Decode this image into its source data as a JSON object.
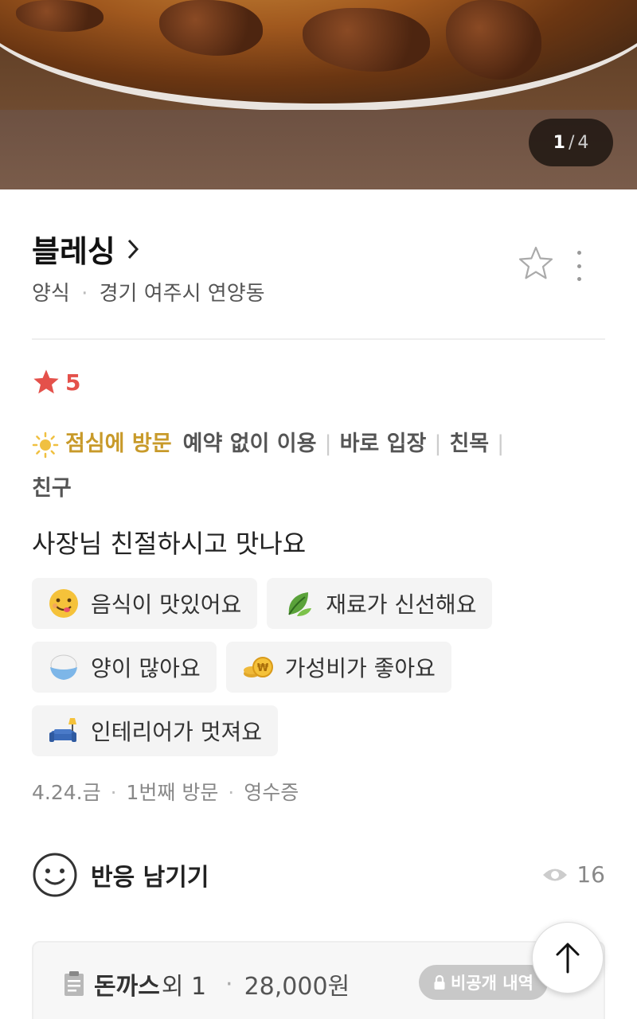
{
  "photo_counter": {
    "current": "1",
    "separator": "/",
    "total": "4"
  },
  "place": {
    "name": "블레싱",
    "category": "양식",
    "location": "경기 여주시 연양동"
  },
  "review": {
    "rating": "5",
    "visit_time": "점심에 방문",
    "visit_details": [
      "예약 없이 이용",
      "바로 입장",
      "친목",
      "친구"
    ],
    "text": "사장님 친절하시고 맛나요",
    "tags": [
      {
        "icon": "yum-face-icon",
        "label": "음식이 맛있어요"
      },
      {
        "icon": "leaf-icon",
        "label": "재료가 신선해요"
      },
      {
        "icon": "rice-bowl-icon",
        "label": "양이 많아요"
      },
      {
        "icon": "coin-icon",
        "label": "가성비가 좋아요"
      },
      {
        "icon": "sofa-lamp-icon",
        "label": "인테리어가 멋져요"
      }
    ],
    "date": "4.24.금",
    "visit_count": "1번째 방문",
    "proof": "영수증"
  },
  "reaction": {
    "label": "반응 남기기",
    "views": "16"
  },
  "receipt": {
    "menu": "돈까스",
    "extra": "외 1",
    "price": "28,000원",
    "private_label": "비공개 내역"
  },
  "colors": {
    "rating": "#e4514b",
    "lunch": "#c89a2a"
  }
}
